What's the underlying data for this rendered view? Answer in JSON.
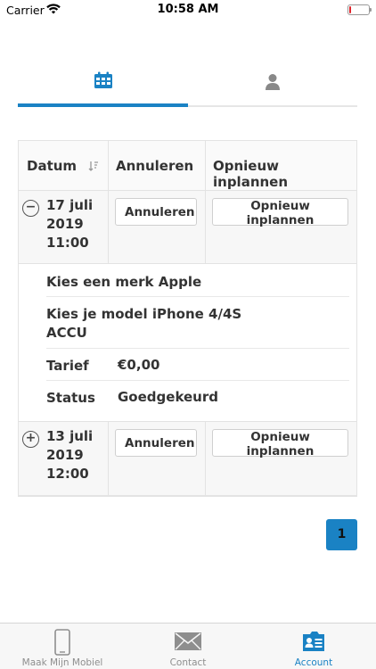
{
  "status_bar": {
    "carrier": "Carrier",
    "time": "10:58 AM",
    "battery_level": 0.1,
    "battery_color": "#e0242b"
  },
  "segment_tabs": [
    {
      "icon": "calendar-icon",
      "active": true
    },
    {
      "icon": "user-icon",
      "active": false
    }
  ],
  "table": {
    "headers": {
      "datum": "Datum",
      "annuleren": "Annuleren",
      "opnieuw": "Opnieuw inplannen"
    },
    "sort_icon": "sort-icon",
    "rows": [
      {
        "expanded": true,
        "toggle": "−",
        "date": "17 juli",
        "year": "2019",
        "time": "11:00",
        "cancel_label": "Annuleren",
        "reschedule_label": "Opnieuw inplannen",
        "details": {
          "brand": "Kies een merk Apple",
          "model_line1": "Kies je model iPhone 4/4S",
          "model_line2": "ACCU",
          "tarief_label": "Tarief",
          "tarief_value": "€0,00",
          "status_label": "Status",
          "status_value": "Goedgekeurd"
        }
      },
      {
        "expanded": false,
        "toggle": "+",
        "date": "13 juli",
        "year": "2019",
        "time": "12:00",
        "cancel_label": "Annuleren",
        "reschedule_label": "Opnieuw inplannen"
      }
    ]
  },
  "pagination": {
    "current_page": "1"
  },
  "tab_bar": {
    "items": [
      {
        "label": "Maak Mijn Mobiel",
        "icon": "phone-icon"
      },
      {
        "label": "Contact",
        "icon": "envelope-icon"
      },
      {
        "label": "Account",
        "icon": "account-card-icon"
      }
    ],
    "active": "Account"
  },
  "colors": {
    "accent": "#1a82c4",
    "inactive": "#8e8e8e"
  }
}
